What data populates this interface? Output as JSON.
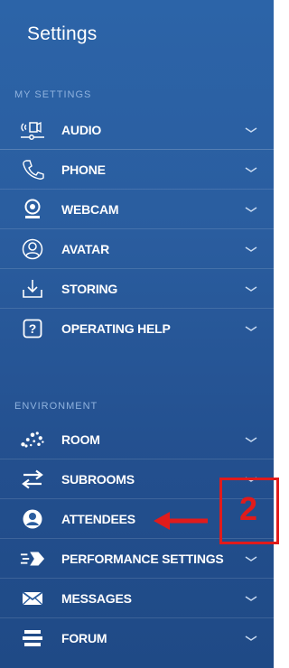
{
  "panel": {
    "title": "Settings"
  },
  "sections": [
    {
      "title": "MY SETTINGS"
    },
    {
      "title": "ENVIRONMENT"
    }
  ],
  "items": [
    {
      "label": "AUDIO",
      "icon": "audio-slider-icon",
      "expandable": true
    },
    {
      "label": "PHONE",
      "icon": "phone-icon",
      "expandable": true
    },
    {
      "label": "WEBCAM",
      "icon": "webcam-icon",
      "expandable": true
    },
    {
      "label": "AVATAR",
      "icon": "avatar-icon",
      "expandable": true
    },
    {
      "label": "STORING",
      "icon": "download-icon",
      "expandable": true
    },
    {
      "label": "OPERATING HELP",
      "icon": "question-icon",
      "expandable": true
    },
    {
      "label": "ROOM",
      "icon": "room-dots-icon",
      "expandable": true
    },
    {
      "label": "SUBROOMS",
      "icon": "swap-arrows-icon",
      "expandable": true
    },
    {
      "label": "ATTENDEES",
      "icon": "attendee-icon",
      "expandable": false
    },
    {
      "label": "PERFORMANCE SETTINGS",
      "icon": "performance-icon",
      "expandable": true
    },
    {
      "label": "MESSAGES",
      "icon": "envelope-icon",
      "expandable": true
    },
    {
      "label": "FORUM",
      "icon": "forum-icon",
      "expandable": true
    }
  ],
  "annotation": {
    "number": "2",
    "color": "#e11b1b"
  },
  "colors": {
    "panel": "#2a5d9f",
    "section_title": "#8fb2de",
    "text": "#ffffff"
  }
}
